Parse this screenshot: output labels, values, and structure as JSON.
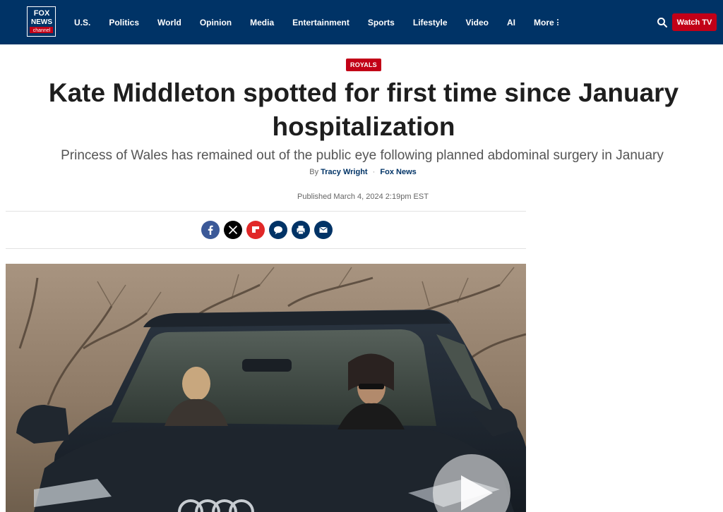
{
  "header": {
    "logo_text": [
      "FOX",
      "NEWS",
      "channel"
    ],
    "nav": [
      "U.S.",
      "Politics",
      "World",
      "Opinion",
      "Media",
      "Entertainment",
      "Sports",
      "Lifestyle",
      "Video",
      "AI"
    ],
    "more_label": "More",
    "watch_tv_label": "Watch TV",
    "icons": {
      "search": "search-icon",
      "more": "vertical-dots-icon"
    }
  },
  "article": {
    "category": "ROYALS",
    "headline": "Kate Middleton spotted for first time since January hospitalization",
    "subheadline": "Princess of Wales has remained out of the public eye following planned abdominal surgery in January",
    "byline_prefix": "By",
    "author": "Tracy Wright",
    "source": "Fox News",
    "published": "Published March 4, 2024 2:19pm EST"
  },
  "share": [
    {
      "name": "facebook",
      "icon": "facebook-icon",
      "color": "#3b5998"
    },
    {
      "name": "x",
      "icon": "x-icon",
      "color": "#000000"
    },
    {
      "name": "flipboard",
      "icon": "flipboard-icon",
      "color": "#e12828"
    },
    {
      "name": "comments",
      "icon": "comment-icon",
      "color": "#003366"
    },
    {
      "name": "print",
      "icon": "print-icon",
      "color": "#003366"
    },
    {
      "name": "email",
      "icon": "email-icon",
      "color": "#003366"
    }
  ],
  "colors": {
    "navy": "#003366",
    "red": "#c20017",
    "headline": "#1e1e1e"
  }
}
